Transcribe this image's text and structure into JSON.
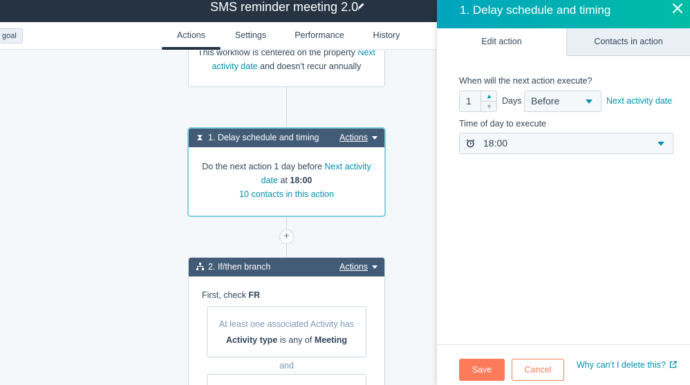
{
  "header": {
    "workflow_title": "SMS reminder meeting 2.0",
    "goal_label": "goal",
    "tabs": [
      "Actions",
      "Settings",
      "Performance",
      "History"
    ],
    "active_tab": "Actions"
  },
  "canvas": {
    "trigger_card": {
      "line1": "This workflow is centered on the property",
      "line1_link": "Next",
      "line2_link": "activity date",
      "line2": "and doesn't recur annually"
    },
    "step1": {
      "title": "1. Delay schedule and timing",
      "actions_label": "Actions",
      "body_prefix": "Do the next action 1 day before",
      "body_link_a": "Next activity",
      "body_link_b": "date",
      "body_at": "at",
      "body_time": "18:00",
      "contacts_link": "10 contacts in this action"
    },
    "add_button": "+",
    "step2": {
      "title": "2. If/then branch",
      "actions_label": "Actions",
      "first_check_prefix": "First, check",
      "first_check_branch": "FR",
      "filter_line1": "At least one associated Activity has",
      "filter_prop": "Activity type",
      "filter_op": "is any of",
      "filter_value": "Meeting",
      "and_label": "and"
    }
  },
  "panel": {
    "title": "1. Delay schedule and timing",
    "tabs": [
      "Edit action",
      "Contacts in action"
    ],
    "question": "When will the next action execute?",
    "amount": "1",
    "unit": "Days",
    "direction": "Before",
    "reference_property": "Next activity date",
    "time_label": "Time of day to execute",
    "time_value": "18:00",
    "save_label": "Save",
    "cancel_label": "Cancel",
    "help_link": "Why can't I delete this?"
  },
  "colors": {
    "header_bg": "#253342",
    "card_header_bg": "#425b76",
    "accent_teal": "#00a4bd",
    "link": "#0091ae",
    "primary_button": "#ff7a59"
  }
}
